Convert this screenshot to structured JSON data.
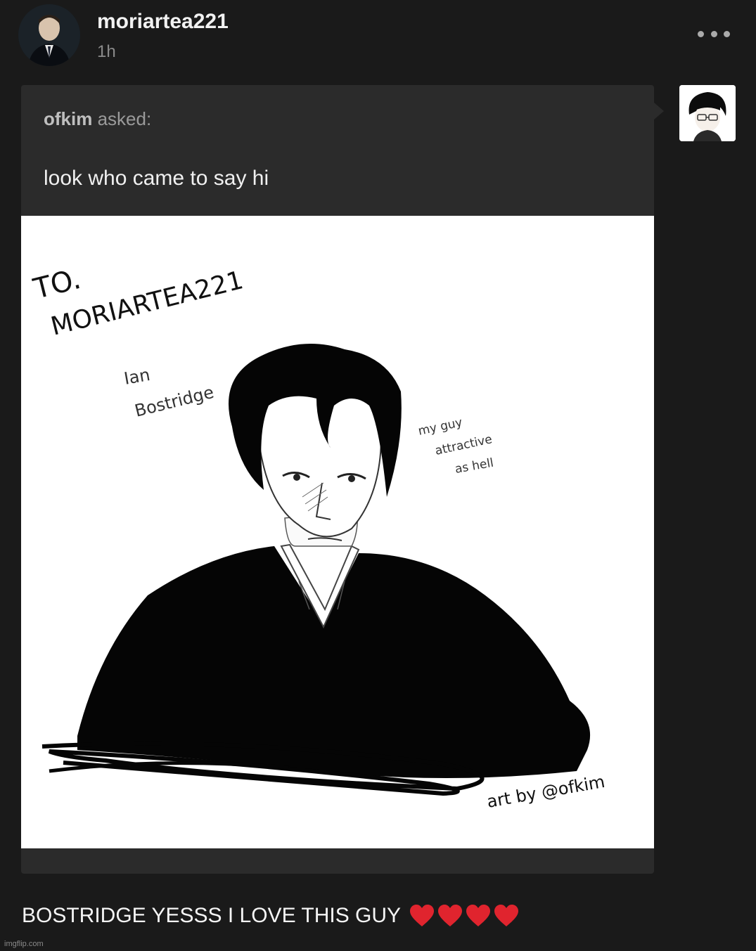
{
  "post": {
    "username": "moriartea221",
    "timestamp": "1h",
    "more_icon": "more-options-icon"
  },
  "ask": {
    "asker": "ofkim",
    "asked_label": "asked:",
    "question": "look who came to say hi"
  },
  "artwork": {
    "dedication": "TO.",
    "dedication_name": "MORIARTEA221",
    "name_line1": "Ian",
    "name_line2": "Bostridge",
    "note_line1": "my guy",
    "note_line2": "attractive",
    "note_line3": "as hell",
    "signature": "art by @ofkim"
  },
  "answer": {
    "text": "BOSTRIDGE YESSS I LOVE THIS GUY",
    "heart_color": "#e0242e",
    "heart_count": 4
  },
  "footer": {
    "watermark": "imgflip.com"
  },
  "colors": {
    "background": "#1a1a1a",
    "card": "#2b2b2b",
    "accent_text": "#f2f2f2",
    "muted_text": "#8a8a8a"
  }
}
